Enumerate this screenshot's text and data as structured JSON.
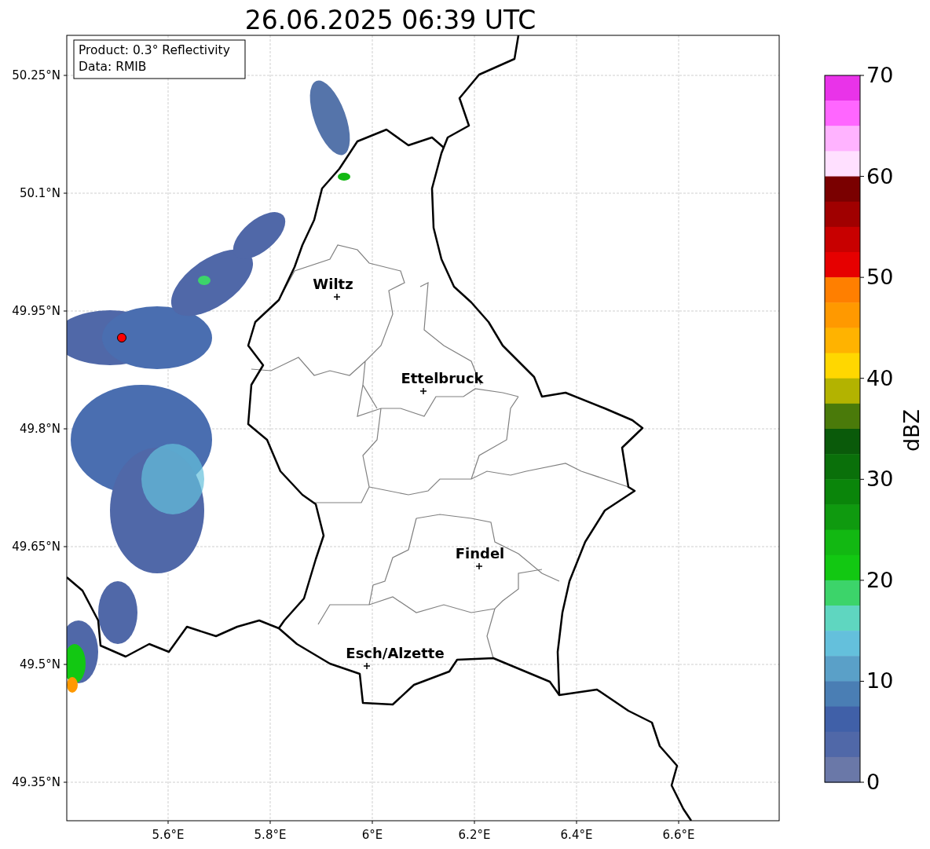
{
  "title": "26.06.2025 06:39 UTC",
  "info_box": [
    "Product: 0.3° Reflectivity",
    "Data: RMIB"
  ],
  "lat_ticks": [
    "50.25°N",
    "50.1°N",
    "49.95°N",
    "49.8°N",
    "49.65°N",
    "49.5°N",
    "49.35°N"
  ],
  "lon_ticks": [
    "5.6°E",
    "5.8°E",
    "6°E",
    "6.2°E",
    "6.4°E",
    "6.6°E"
  ],
  "cities": [
    {
      "name": "Wiltz"
    },
    {
      "name": "Ettelbruck"
    },
    {
      "name": "Findel"
    },
    {
      "name": "Esch/Alzette"
    }
  ],
  "colorbar": {
    "label": "dBZ",
    "ticks": [
      "70",
      "60",
      "50",
      "40",
      "30",
      "20",
      "10",
      "0"
    ],
    "segments": [
      {
        "color": "#e933e9"
      },
      {
        "color": "#ff66ff"
      },
      {
        "color": "#ffb3ff"
      },
      {
        "color": "#ffe0ff"
      },
      {
        "color": "#7a0000"
      },
      {
        "color": "#a00000"
      },
      {
        "color": "#c80000"
      },
      {
        "color": "#e60000"
      },
      {
        "color": "#ff7f00"
      },
      {
        "color": "#ff9900"
      },
      {
        "color": "#ffb300"
      },
      {
        "color": "#ffd700"
      },
      {
        "color": "#b3b300"
      },
      {
        "color": "#4a7a0a"
      },
      {
        "color": "#0a5a0a"
      },
      {
        "color": "#0a700a"
      },
      {
        "color": "#0a850a"
      },
      {
        "color": "#0f9a0f"
      },
      {
        "color": "#12b812"
      },
      {
        "color": "#12c812"
      },
      {
        "color": "#3cd46a"
      },
      {
        "color": "#5fd6c0"
      },
      {
        "color": "#64c0dc"
      },
      {
        "color": "#5aa0c8"
      },
      {
        "color": "#4a7eb4"
      },
      {
        "color": "#4060a8"
      },
      {
        "color": "#5068a8"
      },
      {
        "color": "#6a78a8"
      }
    ]
  }
}
